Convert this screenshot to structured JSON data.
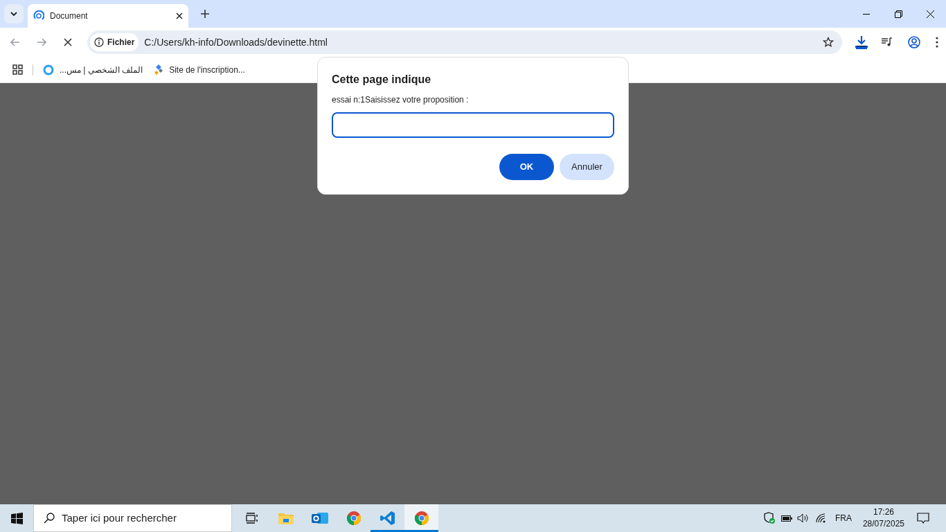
{
  "tabs": [
    {
      "title": "Document",
      "selected": true
    }
  ],
  "address_bar": {
    "badge": "Fichier",
    "url": "C:/Users/kh-info/Downloads/devinette.html"
  },
  "bookmarks": [
    {
      "kind": "circle",
      "label": "الملف الشخصي | مس..."
    },
    {
      "kind": "diamond",
      "label": "Site de l'inscription..."
    }
  ],
  "dialog": {
    "title": "Cette page indique",
    "message": "essai n:1Saisissez votre proposition :",
    "buttons": [
      {
        "label": "OK",
        "primary": true
      },
      {
        "label": "Annuler",
        "primary": false
      }
    ]
  },
  "taskbar": {
    "search_placeholder": "Taper ici pour rechercher",
    "apps": [
      {
        "kind": "taskview",
        "open": false,
        "selected": false
      },
      {
        "kind": "folder",
        "open": false,
        "selected": false
      },
      {
        "kind": "outlook",
        "open": false,
        "selected": false
      },
      {
        "kind": "chrome",
        "open": false,
        "selected": false
      },
      {
        "kind": "vscode",
        "open": true,
        "selected": false
      },
      {
        "kind": "chrome",
        "open": true,
        "selected": true
      }
    ],
    "language": "FRA",
    "time": "17:26",
    "date": "28/07/2025"
  }
}
